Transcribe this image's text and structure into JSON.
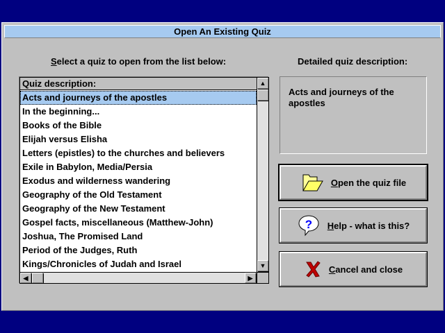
{
  "window": {
    "title": "Open An Existing Quiz"
  },
  "list_label": {
    "hotkey": "S",
    "rest": "elect a quiz to open from the list below:"
  },
  "desc_label": "Detailed quiz description:",
  "list": {
    "header": "Quiz description:",
    "selected_index": 0,
    "items": [
      "Acts and journeys of the apostles",
      "In the beginning...",
      "Books of the Bible",
      "Elijah versus Elisha",
      "Letters (epistles) to the churches and believers",
      "Exile in Babylon, Media/Persia",
      "Exodus and wilderness wandering",
      "Geography of the Old Testament",
      "Geography of the New Testament",
      "Gospel facts, miscellaneous (Matthew-John)",
      "Joshua, The Promised Land",
      "Period of the Judges, Ruth",
      "Kings/Chronicles of Judah and Israel"
    ]
  },
  "description": "Acts and journeys of the apostles",
  "buttons": {
    "open": {
      "hotkey": "O",
      "rest": "pen the quiz file",
      "icon": "folder-icon"
    },
    "help": {
      "hotkey": "H",
      "rest": "elp - what is this?",
      "icon": "help-bubble-icon"
    },
    "cancel": {
      "hotkey": "C",
      "rest": "ancel and close",
      "icon": "red-x-icon"
    }
  }
}
